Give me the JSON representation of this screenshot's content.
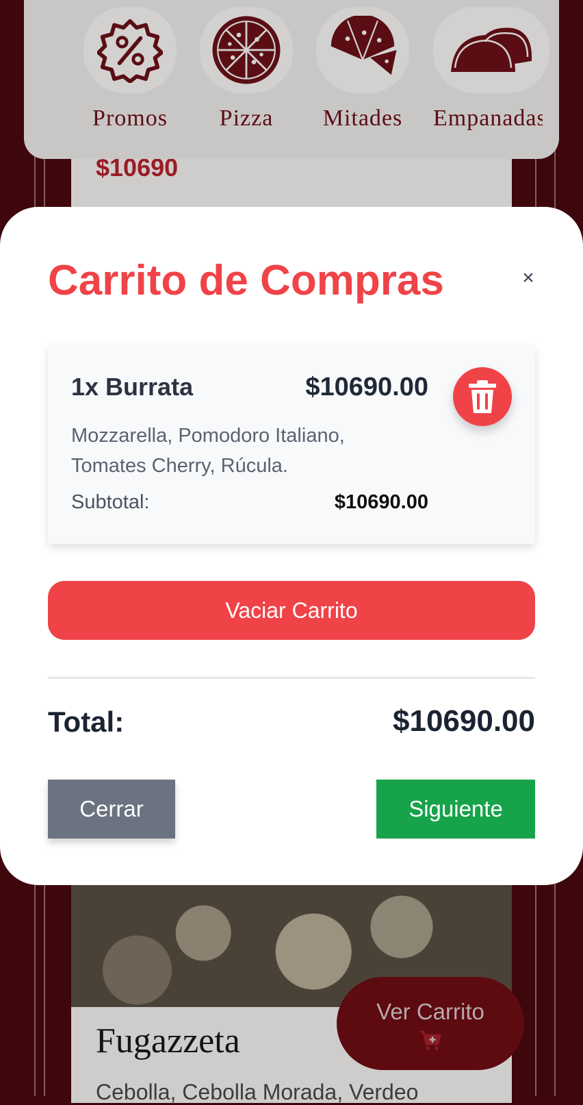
{
  "background": {
    "categories": [
      {
        "label": "Promos",
        "icon": "percent-badge-icon"
      },
      {
        "label": "Pizza",
        "icon": "pizza-icon"
      },
      {
        "label": "Mitades",
        "icon": "half-pizza-icon"
      },
      {
        "label": "Empanadas",
        "icon": "empanadas-icon"
      }
    ],
    "card_price": "$10690",
    "product_title": "Fugazzeta",
    "product_desc": "Cebolla, Cebolla Morada, Verdeo",
    "ver_carrito_label": "Ver Carrito"
  },
  "cart": {
    "title": "Carrito de Compras",
    "close_symbol": "×",
    "items": [
      {
        "name": "1x Burrata",
        "price": "$10690.00",
        "description": "Mozzarella, Pomodoro Italiano, Tomates Cherry, Rúcula.",
        "subtotal_label": "Subtotal:",
        "subtotal": "$10690.00"
      }
    ],
    "empty_button": "Vaciar Carrito",
    "total_label": "Total:",
    "total_value": "$10690.00",
    "close_button": "Cerrar",
    "next_button": "Siguiente"
  },
  "colors": {
    "accent_red": "#ef4348",
    "next_green": "#16a34a",
    "close_gray": "#6b7280",
    "brand_dark_red": "#5d0a10"
  }
}
